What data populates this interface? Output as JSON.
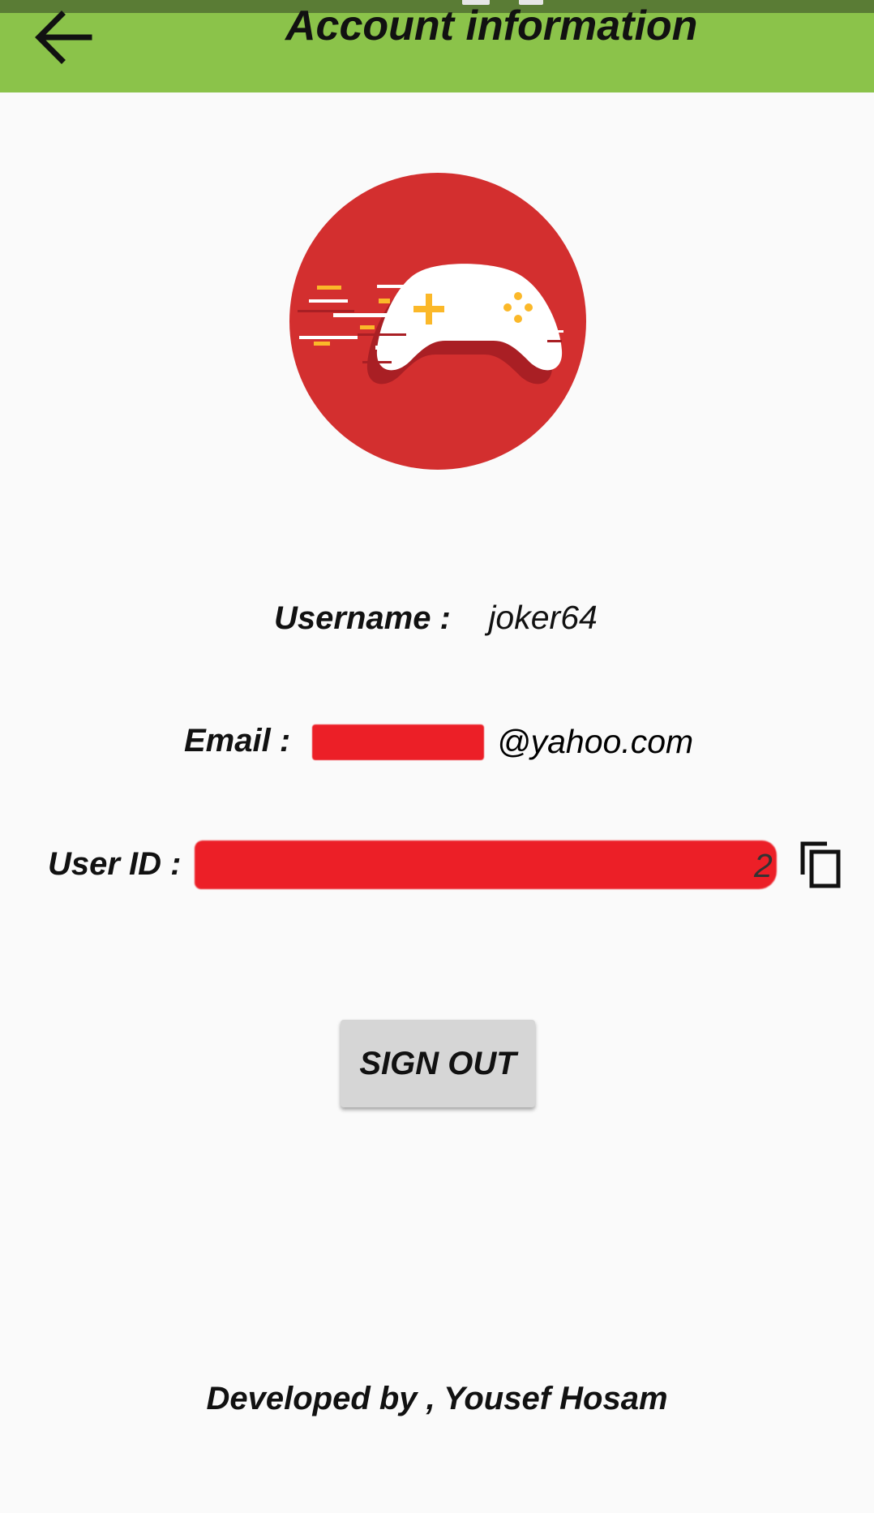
{
  "app_bar": {
    "title": "Account information",
    "background_color": "#8bc34a",
    "back_icon": "arrow-left-icon"
  },
  "avatar": {
    "icon": "gamepad-icon",
    "circle_color": "#d32f2f",
    "accent_color": "#fbb829"
  },
  "account": {
    "username_label": "Username  :",
    "username_value": "joker64",
    "email_label": "Email :",
    "email_value": "@yahoo.com",
    "userid_label": "User ID :",
    "userid_value": "2",
    "copy_icon": "copy-icon"
  },
  "actions": {
    "sign_out_label": "SIGN OUT"
  },
  "footer": {
    "credit": "Developed by , Yousef Hosam"
  }
}
